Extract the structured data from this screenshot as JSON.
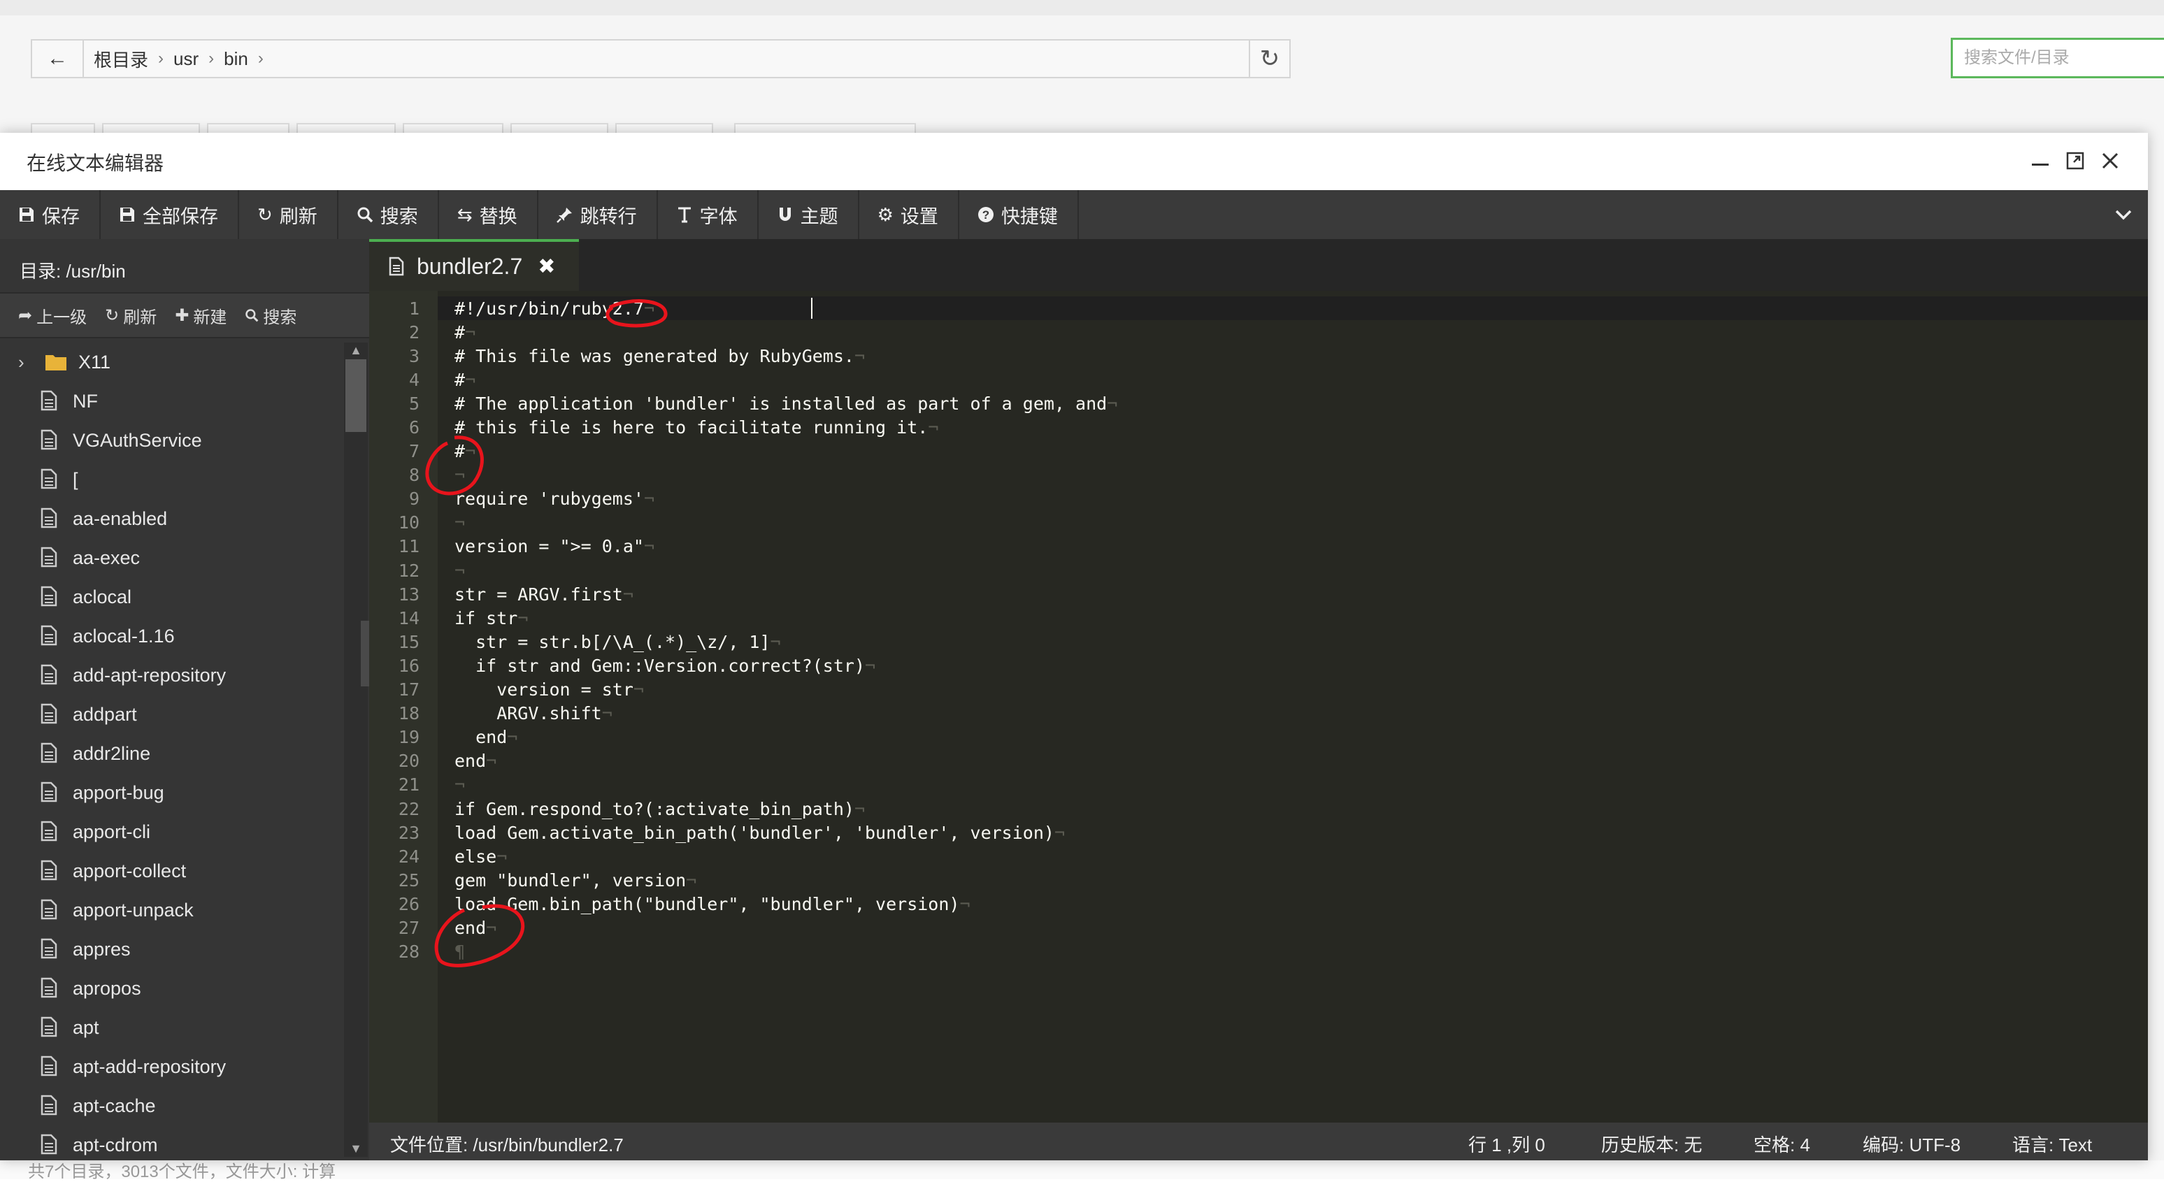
{
  "file_manager": {
    "breadcrumbs": [
      "根目录",
      "usr",
      "bin"
    ],
    "search_placeholder": "搜索文件/目录",
    "bottom_text": "共7个目录，3013个文件，文件大小: 计算"
  },
  "editor": {
    "title": "在线文本编辑器",
    "toolbar": [
      {
        "label": "保存",
        "icon": "floppy-icon"
      },
      {
        "label": "全部保存",
        "icon": "save-all-icon"
      },
      {
        "label": "刷新",
        "icon": "refresh-icon"
      },
      {
        "label": "搜索",
        "icon": "search-icon"
      },
      {
        "label": "替换",
        "icon": "replace-icon"
      },
      {
        "label": "跳转行",
        "icon": "pin-icon"
      },
      {
        "label": "字体",
        "icon": "text-height-icon"
      },
      {
        "label": "主题",
        "icon": "magnet-icon"
      },
      {
        "label": "设置",
        "icon": "gear-icon"
      },
      {
        "label": "快捷键",
        "icon": "question-icon"
      }
    ],
    "sidebar": {
      "dir_label": "目录: /usr/bin",
      "actions": {
        "up": "上一级",
        "refresh": "刷新",
        "new": "新建",
        "search": "搜索"
      },
      "tree": [
        {
          "name": "X11",
          "type": "folder"
        },
        {
          "name": "NF",
          "type": "file"
        },
        {
          "name": "VGAuthService",
          "type": "file"
        },
        {
          "name": "[",
          "type": "file"
        },
        {
          "name": "aa-enabled",
          "type": "file"
        },
        {
          "name": "aa-exec",
          "type": "file"
        },
        {
          "name": "aclocal",
          "type": "file"
        },
        {
          "name": "aclocal-1.16",
          "type": "file"
        },
        {
          "name": "add-apt-repository",
          "type": "file"
        },
        {
          "name": "addpart",
          "type": "file"
        },
        {
          "name": "addr2line",
          "type": "file"
        },
        {
          "name": "apport-bug",
          "type": "file"
        },
        {
          "name": "apport-cli",
          "type": "file"
        },
        {
          "name": "apport-collect",
          "type": "file"
        },
        {
          "name": "apport-unpack",
          "type": "file"
        },
        {
          "name": "appres",
          "type": "file"
        },
        {
          "name": "apropos",
          "type": "file"
        },
        {
          "name": "apt",
          "type": "file"
        },
        {
          "name": "apt-add-repository",
          "type": "file"
        },
        {
          "name": "apt-cache",
          "type": "file"
        },
        {
          "name": "apt-cdrom",
          "type": "file"
        }
      ]
    },
    "tab": {
      "name": "bundler2.7"
    },
    "code_lines": [
      "#!/usr/bin/ruby2.7",
      "#",
      "# This file was generated by RubyGems.",
      "#",
      "# The application 'bundler' is installed as part of a gem, and",
      "# this file is here to facilitate running it.",
      "#",
      "",
      "require 'rubygems'",
      "",
      "version = \">= 0.a\"",
      "",
      "str = ARGV.first",
      "if str",
      "  str = str.b[/\\A_(.*)_\\z/, 1]",
      "  if str and Gem::Version.correct?(str)",
      "    version = str",
      "    ARGV.shift",
      "  end",
      "end",
      "",
      "if Gem.respond_to?(:activate_bin_path)",
      "load Gem.activate_bin_path('bundler', 'bundler', version)",
      "else",
      "gem \"bundler\", version",
      "load Gem.bin_path(\"bundler\", \"bundler\", version)",
      "end",
      ""
    ],
    "status": {
      "file_path": "文件位置: /usr/bin/bundler2.7",
      "cursor": "行 1 ,列 0",
      "history": "历史版本: 无",
      "indent": "空格: 4",
      "encoding": "编码: UTF-8",
      "language": "语言: Text"
    }
  },
  "colors": {
    "toolbar_bg": "#3a3a3a",
    "sidebar_bg": "#353535",
    "editor_bg": "#272822",
    "tab_accent": "#4caf50",
    "annotation": "#e8141c",
    "search_border": "#5cb85c"
  }
}
